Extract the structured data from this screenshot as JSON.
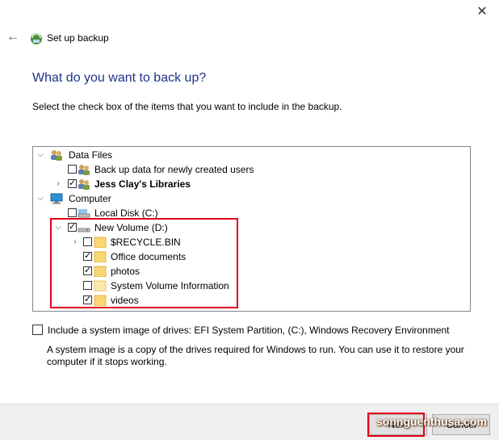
{
  "window": {
    "close_glyph": "✕",
    "back_glyph": "←",
    "title": "Set up backup"
  },
  "page": {
    "heading": "What do you want to back up?",
    "instruction": "Select the check box of the items that you want to include in the backup."
  },
  "tree": {
    "data_files": {
      "label": "Data Files",
      "children": {
        "newly_created": {
          "label": "Back up data for newly created users",
          "checked": false
        },
        "libraries": {
          "label": "Jess Clay's Libraries",
          "checked": true
        }
      }
    },
    "computer": {
      "label": "Computer",
      "children": {
        "local_disk": {
          "label": "Local Disk (C:)",
          "checked": false
        },
        "new_volume": {
          "label": "New Volume (D:)",
          "checked": true,
          "children": {
            "recycle": {
              "label": "$RECYCLE.BIN",
              "checked": false
            },
            "office": {
              "label": "Office documents",
              "checked": true
            },
            "photos": {
              "label": "photos",
              "checked": true
            },
            "svi": {
              "label": "System Volume Information",
              "checked": false
            },
            "videos": {
              "label": "videos",
              "checked": true
            }
          }
        }
      }
    }
  },
  "system_image": {
    "label": "Include a system image of drives: EFI System Partition, (C:), Windows Recovery Environment",
    "checked": false,
    "description": "A system image is a copy of the drives required for Windows to run. You can use it to restore your computer if it stops working."
  },
  "buttons": {
    "next": "Next",
    "cancel": "Cancel"
  },
  "watermark": "sonnguenthusa.com",
  "colors": {
    "heading": "#1e3287",
    "highlight": "#e2001a"
  }
}
